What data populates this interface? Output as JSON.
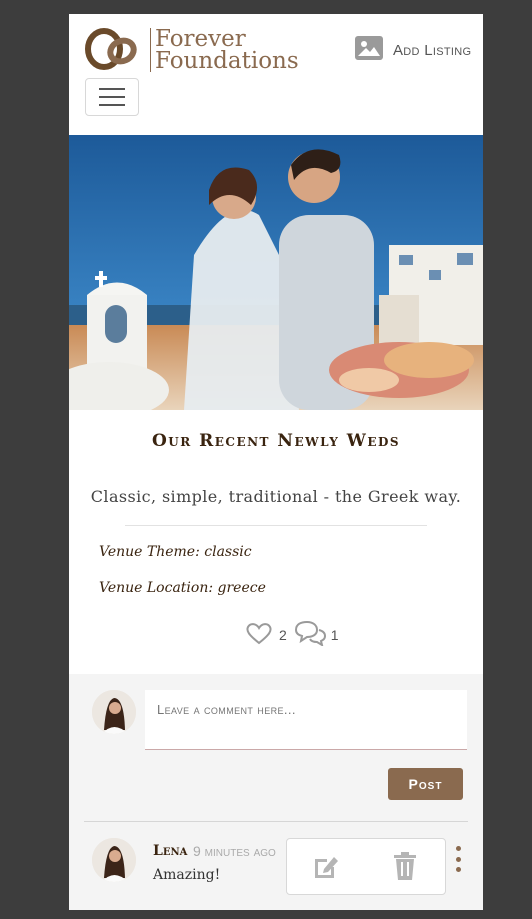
{
  "header": {
    "brand_line1": "Forever",
    "brand_line2": "Foundations",
    "add_listing_label": "Add Listing",
    "icons": {
      "logo": "rings-icon",
      "add_listing": "image-icon",
      "menu": "hamburger-icon"
    }
  },
  "post": {
    "title": "Our Recent Newly Weds",
    "tagline": "Classic, simple, traditional - the Greek way.",
    "theme_label": "Venue Theme:",
    "theme_value": "classic",
    "location_label": "Venue Location:",
    "location_value": "greece",
    "likes": "2",
    "comments_count": "1"
  },
  "comment_form": {
    "placeholder": "Leave a comment here...",
    "post_label": "Post"
  },
  "comments": [
    {
      "author": "Lena",
      "time": "9 minutes ago",
      "text": "Amazing!"
    }
  ],
  "colors": {
    "brand": "#8a6a4f",
    "title": "#3a2410",
    "background": "#3d3d3d"
  }
}
